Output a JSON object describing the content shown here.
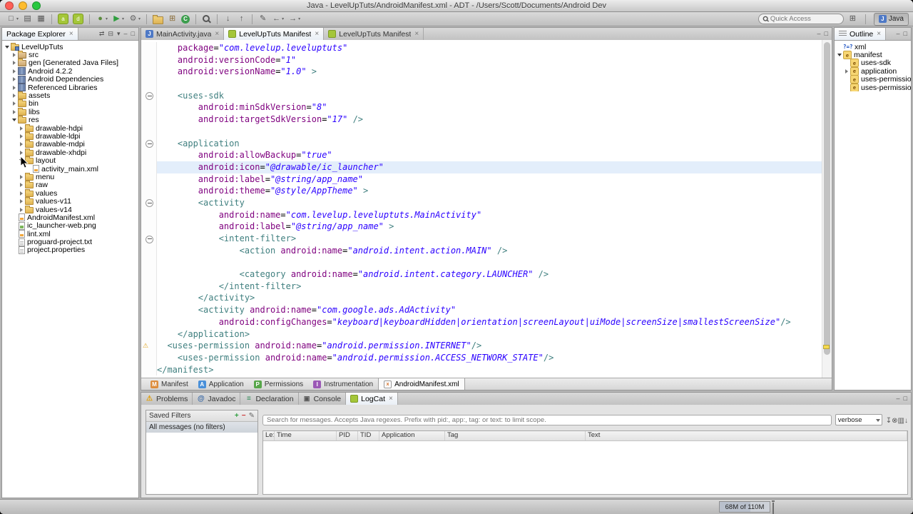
{
  "window": {
    "title": "Java - LevelUpTuts/AndroidManifest.xml - ADT - /Users/Scott/Documents/Android Dev"
  },
  "colors": {
    "xml_tag": "#3f7f7f",
    "xml_attribute": "#7f007f",
    "xml_string": "#2a00ff",
    "current_line_bg": "#e3eefb",
    "android_green": "#a4c639"
  },
  "toolbar": {
    "quick_access_placeholder": "Quick Access",
    "perspective_label": "Java",
    "perspective_badge": "J",
    "groups": [
      [
        {
          "name": "new-wizard",
          "glyph": "□",
          "dropdown": true
        },
        {
          "name": "save",
          "glyph": "▤"
        },
        {
          "name": "print",
          "glyph": "▦"
        }
      ],
      [
        {
          "name": "sdk-manager",
          "cls": "droid",
          "glyph": "a"
        },
        {
          "name": "avd-manager",
          "cls": "droid",
          "glyph": "d"
        }
      ],
      [
        {
          "name": "debug",
          "glyph": "●",
          "color": "#5a8a3c",
          "dropdown": true
        },
        {
          "name": "run",
          "glyph": "▶",
          "color": "#2f9e3f",
          "dropdown": true
        },
        {
          "name": "external-tools",
          "glyph": "⚙",
          "color": "#666",
          "dropdown": true
        }
      ],
      [
        {
          "name": "new-java-project",
          "cls": "folder-ic"
        },
        {
          "name": "new-package",
          "glyph": "⊞",
          "color": "#8a6d3b"
        },
        {
          "name": "new-class",
          "cls": "badge-green",
          "glyph": "C"
        }
      ],
      [
        {
          "name": "search",
          "cls": "mag"
        }
      ],
      [
        {
          "name": "next-annotation",
          "glyph": "↓"
        },
        {
          "name": "prev-annotation",
          "glyph": "↑"
        }
      ],
      [
        {
          "name": "last-edit-location",
          "glyph": "✎"
        },
        {
          "name": "back",
          "glyph": "←",
          "dropdown": true
        },
        {
          "name": "forward",
          "glyph": "→",
          "dropdown": true
        }
      ]
    ]
  },
  "package_explorer": {
    "title": "Package Explorer",
    "header_icons": [
      {
        "name": "link-with-editor",
        "glyph": "⇄"
      },
      {
        "name": "collapse-all",
        "glyph": "⊟"
      },
      {
        "name": "view-menu",
        "glyph": "▾"
      },
      {
        "name": "minimize",
        "glyph": "‒"
      },
      {
        "name": "maximize",
        "glyph": "□"
      }
    ],
    "items": [
      {
        "depth": 0,
        "arrow": "exp",
        "icon": "project",
        "label": "LevelUpTuts"
      },
      {
        "depth": 1,
        "arrow": "col",
        "icon": "src",
        "label": "src"
      },
      {
        "depth": 1,
        "arrow": "col",
        "icon": "src",
        "label": "gen [Generated Java Files]"
      },
      {
        "depth": 1,
        "arrow": "col",
        "icon": "lib",
        "label": "Android 4.2.2"
      },
      {
        "depth": 1,
        "arrow": "col",
        "icon": "lib",
        "label": "Android Dependencies"
      },
      {
        "depth": 1,
        "arrow": "col",
        "icon": "lib",
        "label": "Referenced Libraries"
      },
      {
        "depth": 1,
        "arrow": "col",
        "icon": "folder",
        "label": "assets"
      },
      {
        "depth": 1,
        "arrow": "col",
        "icon": "folder",
        "label": "bin"
      },
      {
        "depth": 1,
        "arrow": "col",
        "icon": "folder",
        "label": "libs"
      },
      {
        "depth": 1,
        "arrow": "exp",
        "icon": "folder",
        "label": "res"
      },
      {
        "depth": 2,
        "arrow": "col",
        "icon": "folder",
        "label": "drawable-hdpi"
      },
      {
        "depth": 2,
        "arrow": "col",
        "icon": "folder",
        "label": "drawable-ldpi"
      },
      {
        "depth": 2,
        "arrow": "col",
        "icon": "folder",
        "label": "drawable-mdpi"
      },
      {
        "depth": 2,
        "arrow": "col",
        "icon": "folder",
        "label": "drawable-xhdpi"
      },
      {
        "depth": 2,
        "arrow": "exp",
        "icon": "folder",
        "label": "layout"
      },
      {
        "depth": 3,
        "arrow": "none",
        "icon": "xmlfile",
        "label": "activity_main.xml"
      },
      {
        "depth": 2,
        "arrow": "col",
        "icon": "folder",
        "label": "menu"
      },
      {
        "depth": 2,
        "arrow": "col",
        "icon": "folder",
        "label": "raw"
      },
      {
        "depth": 2,
        "arrow": "col",
        "icon": "folder",
        "label": "values"
      },
      {
        "depth": 2,
        "arrow": "col",
        "icon": "folder",
        "label": "values-v11"
      },
      {
        "depth": 2,
        "arrow": "col",
        "icon": "folder",
        "label": "values-v14"
      },
      {
        "depth": 1,
        "arrow": "none",
        "icon": "xmlfile",
        "label": "AndroidManifest.xml"
      },
      {
        "depth": 1,
        "arrow": "none",
        "icon": "imgfile",
        "label": "ic_launcher-web.png"
      },
      {
        "depth": 1,
        "arrow": "none",
        "icon": "xmlfile",
        "label": "lint.xml"
      },
      {
        "depth": 1,
        "arrow": "none",
        "icon": "file",
        "label": "proguard-project.txt"
      },
      {
        "depth": 1,
        "arrow": "none",
        "icon": "file",
        "label": "project.properties"
      }
    ]
  },
  "editor": {
    "tabs": [
      {
        "label": "MainActivity.java",
        "icon": "java",
        "badge": "J",
        "closable": true
      },
      {
        "label": "LevelUpTuts Manifest",
        "icon": "android",
        "selected": true,
        "closable": true
      },
      {
        "label": "LevelUpTuts Manifest",
        "icon": "android",
        "closable": true
      }
    ],
    "header_icons": [
      {
        "name": "minimize",
        "glyph": "‒"
      },
      {
        "name": "maximize",
        "glyph": "□"
      }
    ],
    "highlighted_line": 10,
    "warning_line": 25,
    "fold_lines": [
      4,
      8,
      13,
      16
    ],
    "code_lines": [
      "    package=\"com.levelup.leveluptuts\"",
      "    android:versionCode=\"1\"",
      "    android:versionName=\"1.0\" >",
      "",
      "    <uses-sdk",
      "        android:minSdkVersion=\"8\"",
      "        android:targetSdkVersion=\"17\" />",
      "",
      "    <application",
      "        android:allowBackup=\"true\"",
      "        android:icon=\"@drawable/ic_launcher\"",
      "        android:label=\"@string/app_name\"",
      "        android:theme=\"@style/AppTheme\" >",
      "        <activity",
      "            android:name=\"com.levelup.leveluptuts.MainActivity\"",
      "            android:label=\"@string/app_name\" >",
      "            <intent-filter>",
      "                <action android:name=\"android.intent.action.MAIN\" />",
      "",
      "                <category android:name=\"android.intent.category.LAUNCHER\" />",
      "            </intent-filter>",
      "        </activity>",
      "        <activity android:name=\"com.google.ads.AdActivity\"",
      "            android:configChanges=\"keyboard|keyboardHidden|orientation|screenLayout|uiMode|screenSize|smallestScreenSize\"/>",
      "    </application>",
      "  <uses-permission android:name=\"android.permission.INTERNET\"/>",
      "    <uses-permission android:name=\"android.permission.ACCESS_NETWORK_STATE\"/>",
      "</manifest>"
    ],
    "form_tabs": [
      {
        "label": "Manifest",
        "icon": "m",
        "badge": "M"
      },
      {
        "label": "Application",
        "icon": "a",
        "badge": "A"
      },
      {
        "label": "Permissions",
        "icon": "p",
        "badge": "P"
      },
      {
        "label": "Instrumentation",
        "icon": "i",
        "badge": "I"
      },
      {
        "label": "AndroidManifest.xml",
        "icon": "xmlfile",
        "badge": "x",
        "selected": true
      }
    ]
  },
  "outline": {
    "title": "Outline",
    "header_icons": [
      {
        "name": "minimize",
        "glyph": "‒"
      },
      {
        "name": "maximize",
        "glyph": "□"
      }
    ],
    "items": [
      {
        "depth": 0,
        "arrow": "none",
        "icon": "xml-decl",
        "label": "xml"
      },
      {
        "depth": 0,
        "arrow": "exp",
        "icon": "element",
        "label": "manifest"
      },
      {
        "depth": 1,
        "arrow": "none",
        "icon": "element",
        "label": "uses-sdk"
      },
      {
        "depth": 1,
        "arrow": "col",
        "icon": "element",
        "label": "application"
      },
      {
        "depth": 1,
        "arrow": "none",
        "icon": "element",
        "label": "uses-permission: a"
      },
      {
        "depth": 1,
        "arrow": "none",
        "icon": "element",
        "label": "uses-permission: a"
      }
    ]
  },
  "bottom_panel": {
    "tabs": [
      {
        "label": "Problems",
        "icon": "problems",
        "badge": "⚠"
      },
      {
        "label": "Javadoc",
        "icon": "javadoc",
        "badge": "@"
      },
      {
        "label": "Declaration",
        "icon": "declaration",
        "badge": "≡"
      },
      {
        "label": "Console",
        "icon": "console",
        "badge": "▣"
      },
      {
        "label": "LogCat",
        "icon": "android",
        "selected": true,
        "closable": true
      }
    ],
    "header_icons": [
      {
        "name": "minimize",
        "glyph": "‒"
      },
      {
        "name": "maximize",
        "glyph": "□"
      }
    ],
    "logcat": {
      "saved_filters_title": "Saved Filters",
      "filter_buttons": [
        {
          "name": "add-filter",
          "glyph": "+",
          "cls": "sf-add"
        },
        {
          "name": "remove-filter",
          "glyph": "−",
          "cls": "sf-remove"
        },
        {
          "name": "edit-filter",
          "glyph": "✎",
          "cls": "sf-edit"
        }
      ],
      "filter_items": [
        "All messages (no filters)"
      ],
      "selected_filter": 0,
      "search_placeholder": "Search for messages. Accepts Java regexes. Prefix with pid:, app:, tag: or text: to limit scope.",
      "level_dropdown": "verbose",
      "toolbar_icons": [
        {
          "name": "export-log",
          "glyph": "↧"
        },
        {
          "name": "clear-log",
          "glyph": "⊗"
        },
        {
          "name": "show-filters-view",
          "glyph": "▥"
        },
        {
          "name": "autoscroll",
          "glyph": "↓"
        }
      ],
      "columns": [
        {
          "label": "Le:",
          "width": 16
        },
        {
          "label": "Time",
          "width": 87
        },
        {
          "label": "PID",
          "width": 30
        },
        {
          "label": "TID",
          "width": 30
        },
        {
          "label": "Application",
          "width": 92
        },
        {
          "label": "Tag",
          "width": 197
        },
        {
          "label": "Text",
          "width": 0
        }
      ]
    }
  },
  "status_bar": {
    "memory": "68M of 110M"
  }
}
